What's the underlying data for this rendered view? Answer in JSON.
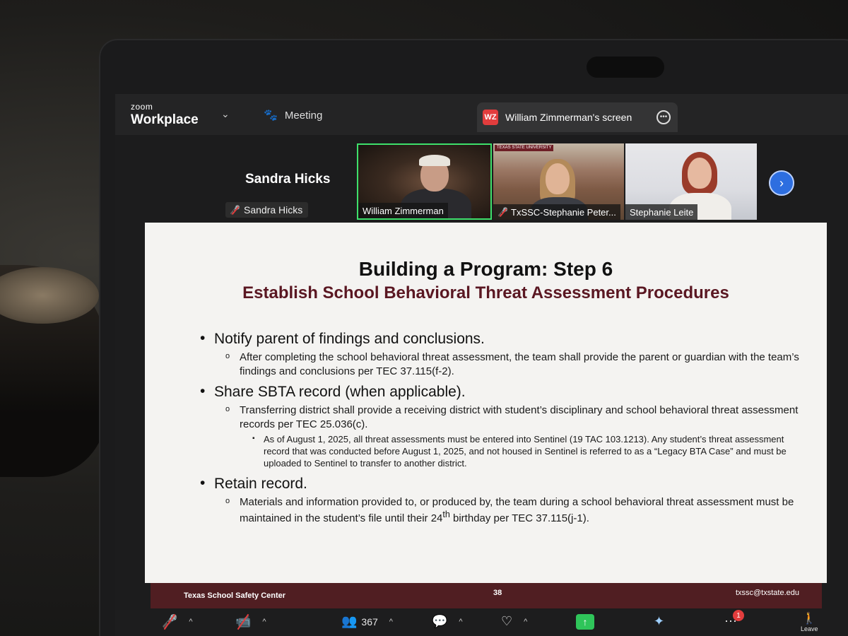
{
  "app": {
    "brand_top": "zoom",
    "brand_bottom": "Workplace",
    "meeting_tab": "Meeting",
    "share_badge": "WZ",
    "share_title": "William Zimmerman's screen"
  },
  "participants": {
    "self_name": "Sandra Hicks",
    "self_label": "Sandra Hicks",
    "tiles": [
      {
        "name": "William Zimmerman",
        "muted": false
      },
      {
        "name": "TxSSC-Stephanie Peter...",
        "muted": true,
        "badge": "TEXAS STATE UNIVERSITY"
      },
      {
        "name": "Stephanie Leite",
        "muted": false
      }
    ]
  },
  "slide": {
    "title": "Building a Program: Step 6",
    "subtitle": "Establish School Behavioral Threat Assessment Procedures",
    "bullets": [
      {
        "text": "Notify parent of findings and conclusions.",
        "sub": "After completing the school behavioral threat assessment, the team shall provide the parent or guardian with the team’s findings and conclusions per TEC 37.115(f-2)."
      },
      {
        "text": "Share SBTA record (when applicable).",
        "sub": "Transferring district shall provide a receiving district with student’s disciplinary and school behavioral threat assessment records per TEC 25.036(c).",
        "subsub": "As of August 1, 2025, all threat assessments must be entered into Sentinel (19 TAC 103.1213). Any student’s threat assessment record that was conducted before August 1, 2025, and not housed in Sentinel is referred to as a “Legacy BTA Case” and must be uploaded to Sentinel to transfer to another district."
      },
      {
        "text": "Retain record.",
        "sub_before": "Materials and information provided to, or produced by, the team during a school behavioral threat assessment must be maintained in the student’s file until their 24",
        "sub_sup": "th",
        "sub_after": " birthday per TEC 37.115(j-1)."
      }
    ],
    "footer_left": "Texas School Safety Center",
    "footer_page": "38",
    "footer_right": "txssc@txstate.edu"
  },
  "toolbar": {
    "participant_count": "367",
    "chat_badge": "1",
    "leave_label": "Leave"
  },
  "colors": {
    "accent_green": "#3ee06b",
    "slide_maroon": "#501e22",
    "subtitle_maroon": "#5a1722",
    "zoom_blue": "#2d6ee0",
    "alert_red": "#e23d3d"
  }
}
